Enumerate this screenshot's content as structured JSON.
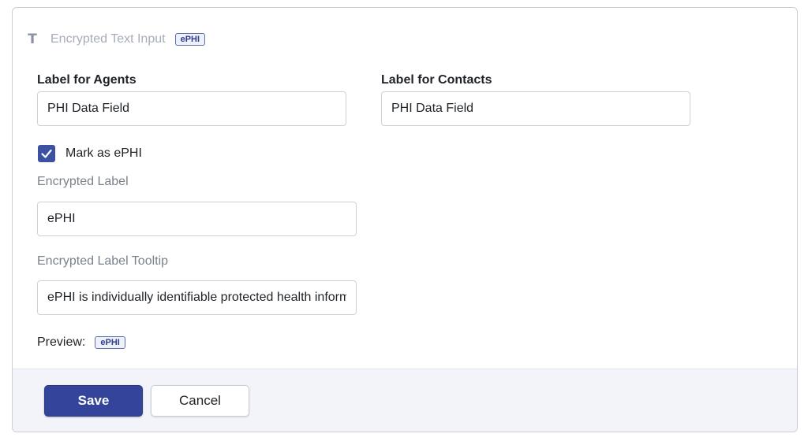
{
  "field": {
    "type_icon": "T",
    "type_name": "Encrypted Text Input",
    "badge": "ePHI"
  },
  "agents": {
    "label": "Label for Agents",
    "value": "PHI Data Field"
  },
  "contacts": {
    "label": "Label for Contacts",
    "value": "PHI Data Field"
  },
  "mark_ephi": {
    "label": "Mark as ePHI",
    "checked": true
  },
  "encrypted_label": {
    "label": "Encrypted Label",
    "value": "ePHI"
  },
  "encrypted_tooltip": {
    "label": "Encrypted Label Tooltip",
    "value": "ePHI is individually identifiable protected health information"
  },
  "preview": {
    "label": "Preview:",
    "badge": "ePHI"
  },
  "footer": {
    "save_label": "Save",
    "cancel_label": "Cancel"
  },
  "colors": {
    "accent": "#33449a",
    "badge_border": "#5c6fa8",
    "footer_bg": "#f3f4f9"
  }
}
